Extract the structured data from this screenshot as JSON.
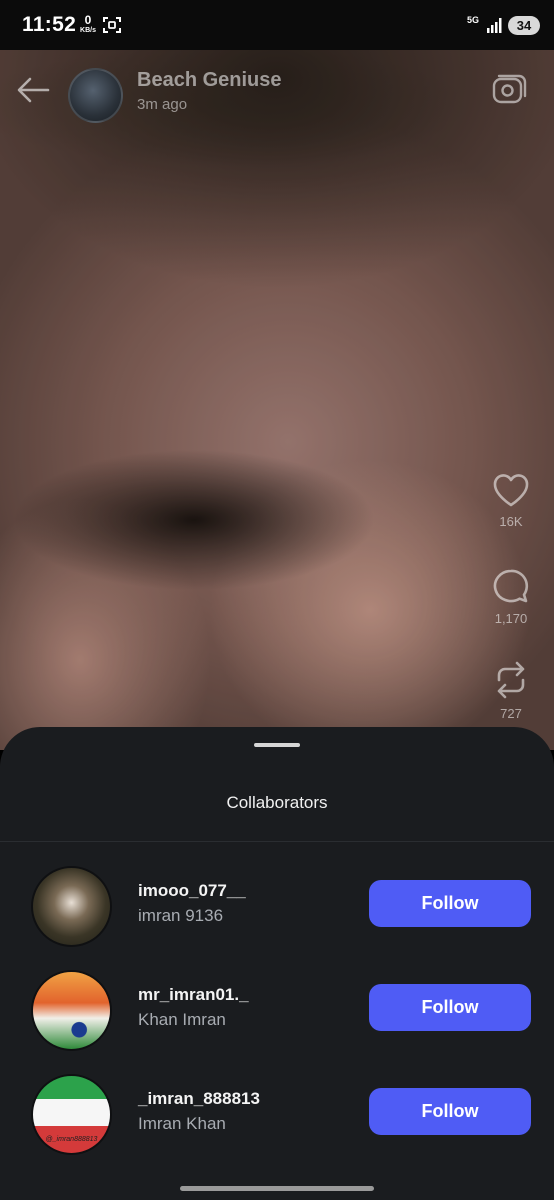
{
  "status_bar": {
    "time": "11:52",
    "net_speed_value": "0",
    "net_speed_unit": "KB/s",
    "network_type": "5G",
    "battery_level": "34"
  },
  "post": {
    "account_name": "Beach Geniuse",
    "time_ago": "3m ago",
    "likes": "16K",
    "comments": "1,170",
    "reposts": "727"
  },
  "sheet": {
    "title": "Collaborators",
    "collaborators": [
      {
        "username": "imooo_077__",
        "display_name": "imran 9136",
        "button": "Follow"
      },
      {
        "username": "mr_imran01._",
        "display_name": "Khan Imran",
        "button": "Follow"
      },
      {
        "username": "_imran_888813",
        "display_name": "Imran Khan",
        "button": "Follow",
        "avatar_watermark": "@_imran888813"
      }
    ]
  },
  "colors": {
    "follow_button": "#4f5cf5",
    "sheet_background": "#1a1c1f"
  }
}
